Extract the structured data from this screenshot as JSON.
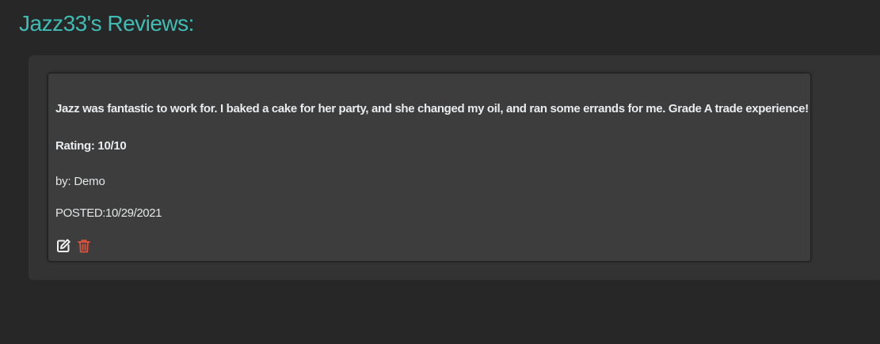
{
  "page": {
    "title": "Jazz33's Reviews:"
  },
  "review": {
    "text": "Jazz was fantastic to work for. I baked a cake for her party, and she changed my oil, and ran some errands for me. Grade A trade experience!",
    "rating": "Rating: 10/10",
    "author": "by: Demo",
    "posted": "POSTED:10/29/2021",
    "actions": {
      "edit_icon": "edit-icon",
      "delete_icon": "trash-icon"
    }
  },
  "colors": {
    "background": "#272727",
    "panel": "#333333",
    "card": "#3d3d3d",
    "title_accent": "#3fbdb4",
    "text": "#e9ecef",
    "delete": "#e0533d"
  }
}
